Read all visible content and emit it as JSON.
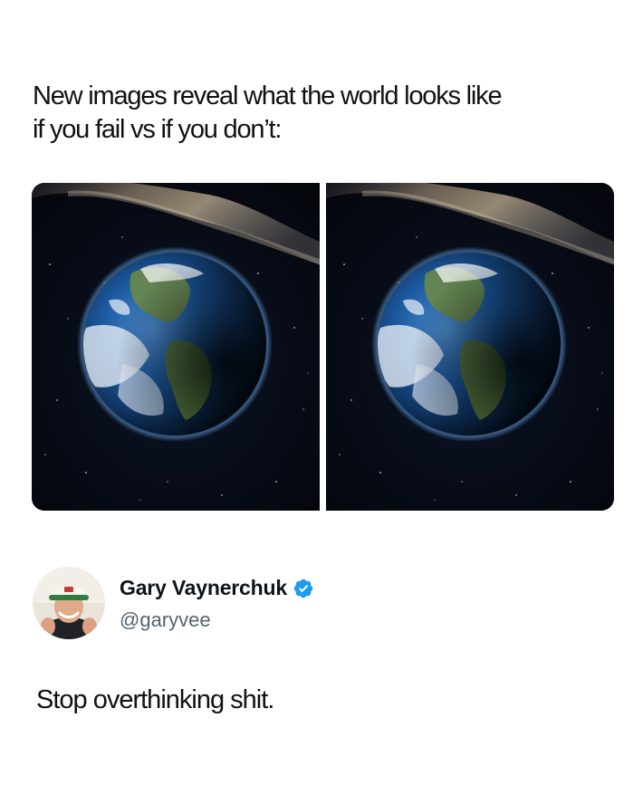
{
  "headline": {
    "line1": "New images reveal what the world looks like",
    "line2": "if you fail vs if you don’t:"
  },
  "images": [
    {
      "subject": "earth-from-space",
      "side": "left"
    },
    {
      "subject": "earth-from-space",
      "side": "right"
    }
  ],
  "author": {
    "display_name": "Gary Vaynerchuk",
    "handle": "@garyvee",
    "verified": true
  },
  "post": {
    "text": "Stop overthinking shit."
  },
  "colors": {
    "verified_badge": "#1d9bf0",
    "handle": "#536471",
    "text": "#111111",
    "background": "#ffffff",
    "space": "#05080f",
    "ocean": "#1a4f8f"
  },
  "icons": {
    "verified": "verified-badge-icon"
  }
}
